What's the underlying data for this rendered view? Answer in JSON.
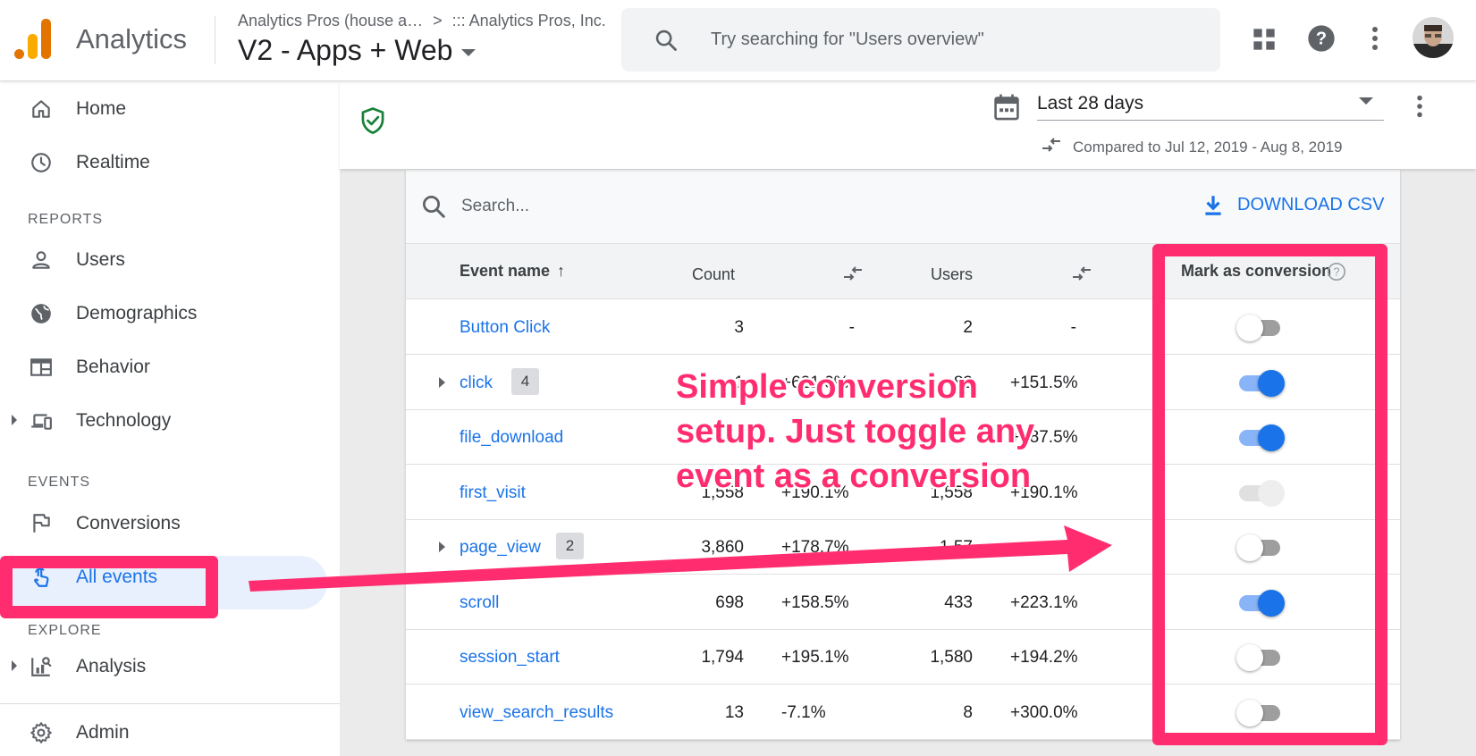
{
  "header": {
    "app_name": "Analytics",
    "account_crumb": "Analytics Pros (house a…",
    "crumb_separator": ">",
    "org_crumb": "::: Analytics Pros, Inc.",
    "property_name": "V2 - Apps + Web",
    "search_placeholder": "Try searching for \"Users overview\"",
    "icons": [
      "apps-grid-icon",
      "help-icon",
      "more-vert-icon",
      "avatar"
    ]
  },
  "sidebar": {
    "home": "Home",
    "realtime": "Realtime",
    "reports_section": "REPORTS",
    "users": "Users",
    "demographics": "Demographics",
    "behavior": "Behavior",
    "technology": "Technology",
    "events_section": "EVENTS",
    "conversions": "Conversions",
    "all_events": "All events",
    "explore_section": "EXPLORE",
    "analysis": "Analysis",
    "admin": "Admin"
  },
  "toolbar": {
    "date_range": "Last 28 days",
    "comparison": "Compared to Jul 12, 2019 - Aug 8, 2019"
  },
  "table": {
    "search_placeholder": "Search...",
    "download_label": "DOWNLOAD CSV",
    "columns": {
      "event_name": "Event name",
      "count": "Count",
      "users": "Users",
      "mark_conversion": "Mark as conversion"
    },
    "rows": [
      {
        "name": "Button Click",
        "count": "3",
        "count_change": "-",
        "users": "2",
        "users_change": "-",
        "conversion": "off"
      },
      {
        "name": "click",
        "badge": "4",
        "count": "1",
        "count_change": "+621.0%",
        "users": "83",
        "users_change": "+151.5%",
        "conversion": "on"
      },
      {
        "name": "file_download",
        "count": "",
        "count_change": "",
        "users": "",
        "users_change": "+187.5%",
        "conversion": "on"
      },
      {
        "name": "first_visit",
        "count": "1,558",
        "count_change": "+190.1%",
        "users": "1,558",
        "users_change": "+190.1%",
        "conversion": "disabled"
      },
      {
        "name": "page_view",
        "badge": "2",
        "count": "3,860",
        "count_change": "+178.7%",
        "users": "1,57",
        "users_change": "",
        "conversion": "off"
      },
      {
        "name": "scroll",
        "count": "698",
        "count_change": "+158.5%",
        "users": "433",
        "users_change": "+223.1%",
        "conversion": "on"
      },
      {
        "name": "session_start",
        "count": "1,794",
        "count_change": "+195.1%",
        "users": "1,580",
        "users_change": "+194.2%",
        "conversion": "off"
      },
      {
        "name": "view_search_results",
        "count": "13",
        "count_change": "-7.1%",
        "users": "8",
        "users_change": "+300.0%",
        "conversion": "off"
      }
    ]
  },
  "annotation": {
    "line1": "Simple conversion",
    "line2": "setup. Just toggle any",
    "line3": "event as a conversion",
    "color": "#ff2d6f"
  },
  "colors": {
    "accent": "#1a73e8",
    "positive": "#188038",
    "negative": "#d93025",
    "shield": "#188038"
  }
}
